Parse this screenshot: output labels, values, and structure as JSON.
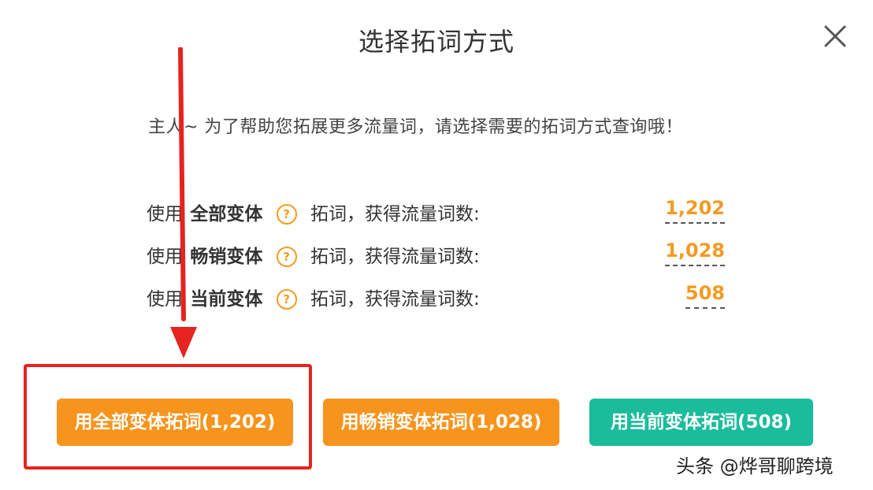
{
  "dialog": {
    "title": "选择拓词方式",
    "close_icon": "close-icon",
    "intro": "主人~ 为了帮助您拓展更多流量词，请选择需要的拓词方式查询哦！"
  },
  "options": [
    {
      "prefix": "使用",
      "variant": "全部变体",
      "suffix": "拓词，获得流量词数:",
      "count": "1,202"
    },
    {
      "prefix": "使用",
      "variant": "畅销变体",
      "suffix": "拓词，获得流量词数:",
      "count": "1,028"
    },
    {
      "prefix": "使用",
      "variant": "当前变体",
      "suffix": "拓词，获得流量词数:",
      "count": "508"
    }
  ],
  "help_glyph": "?",
  "buttons": [
    {
      "label": "用全部变体拓词(1,202)",
      "color": "#f7941d"
    },
    {
      "label": "用畅销变体拓词(1,028)",
      "color": "#f7941d"
    },
    {
      "label": "用当前变体拓词(508)",
      "color": "#1bbc9b"
    }
  ],
  "annotation": {
    "arrow_color": "#e5231f",
    "box_color": "#e5231f"
  },
  "watermark": "头条 @烨哥聊跨境"
}
